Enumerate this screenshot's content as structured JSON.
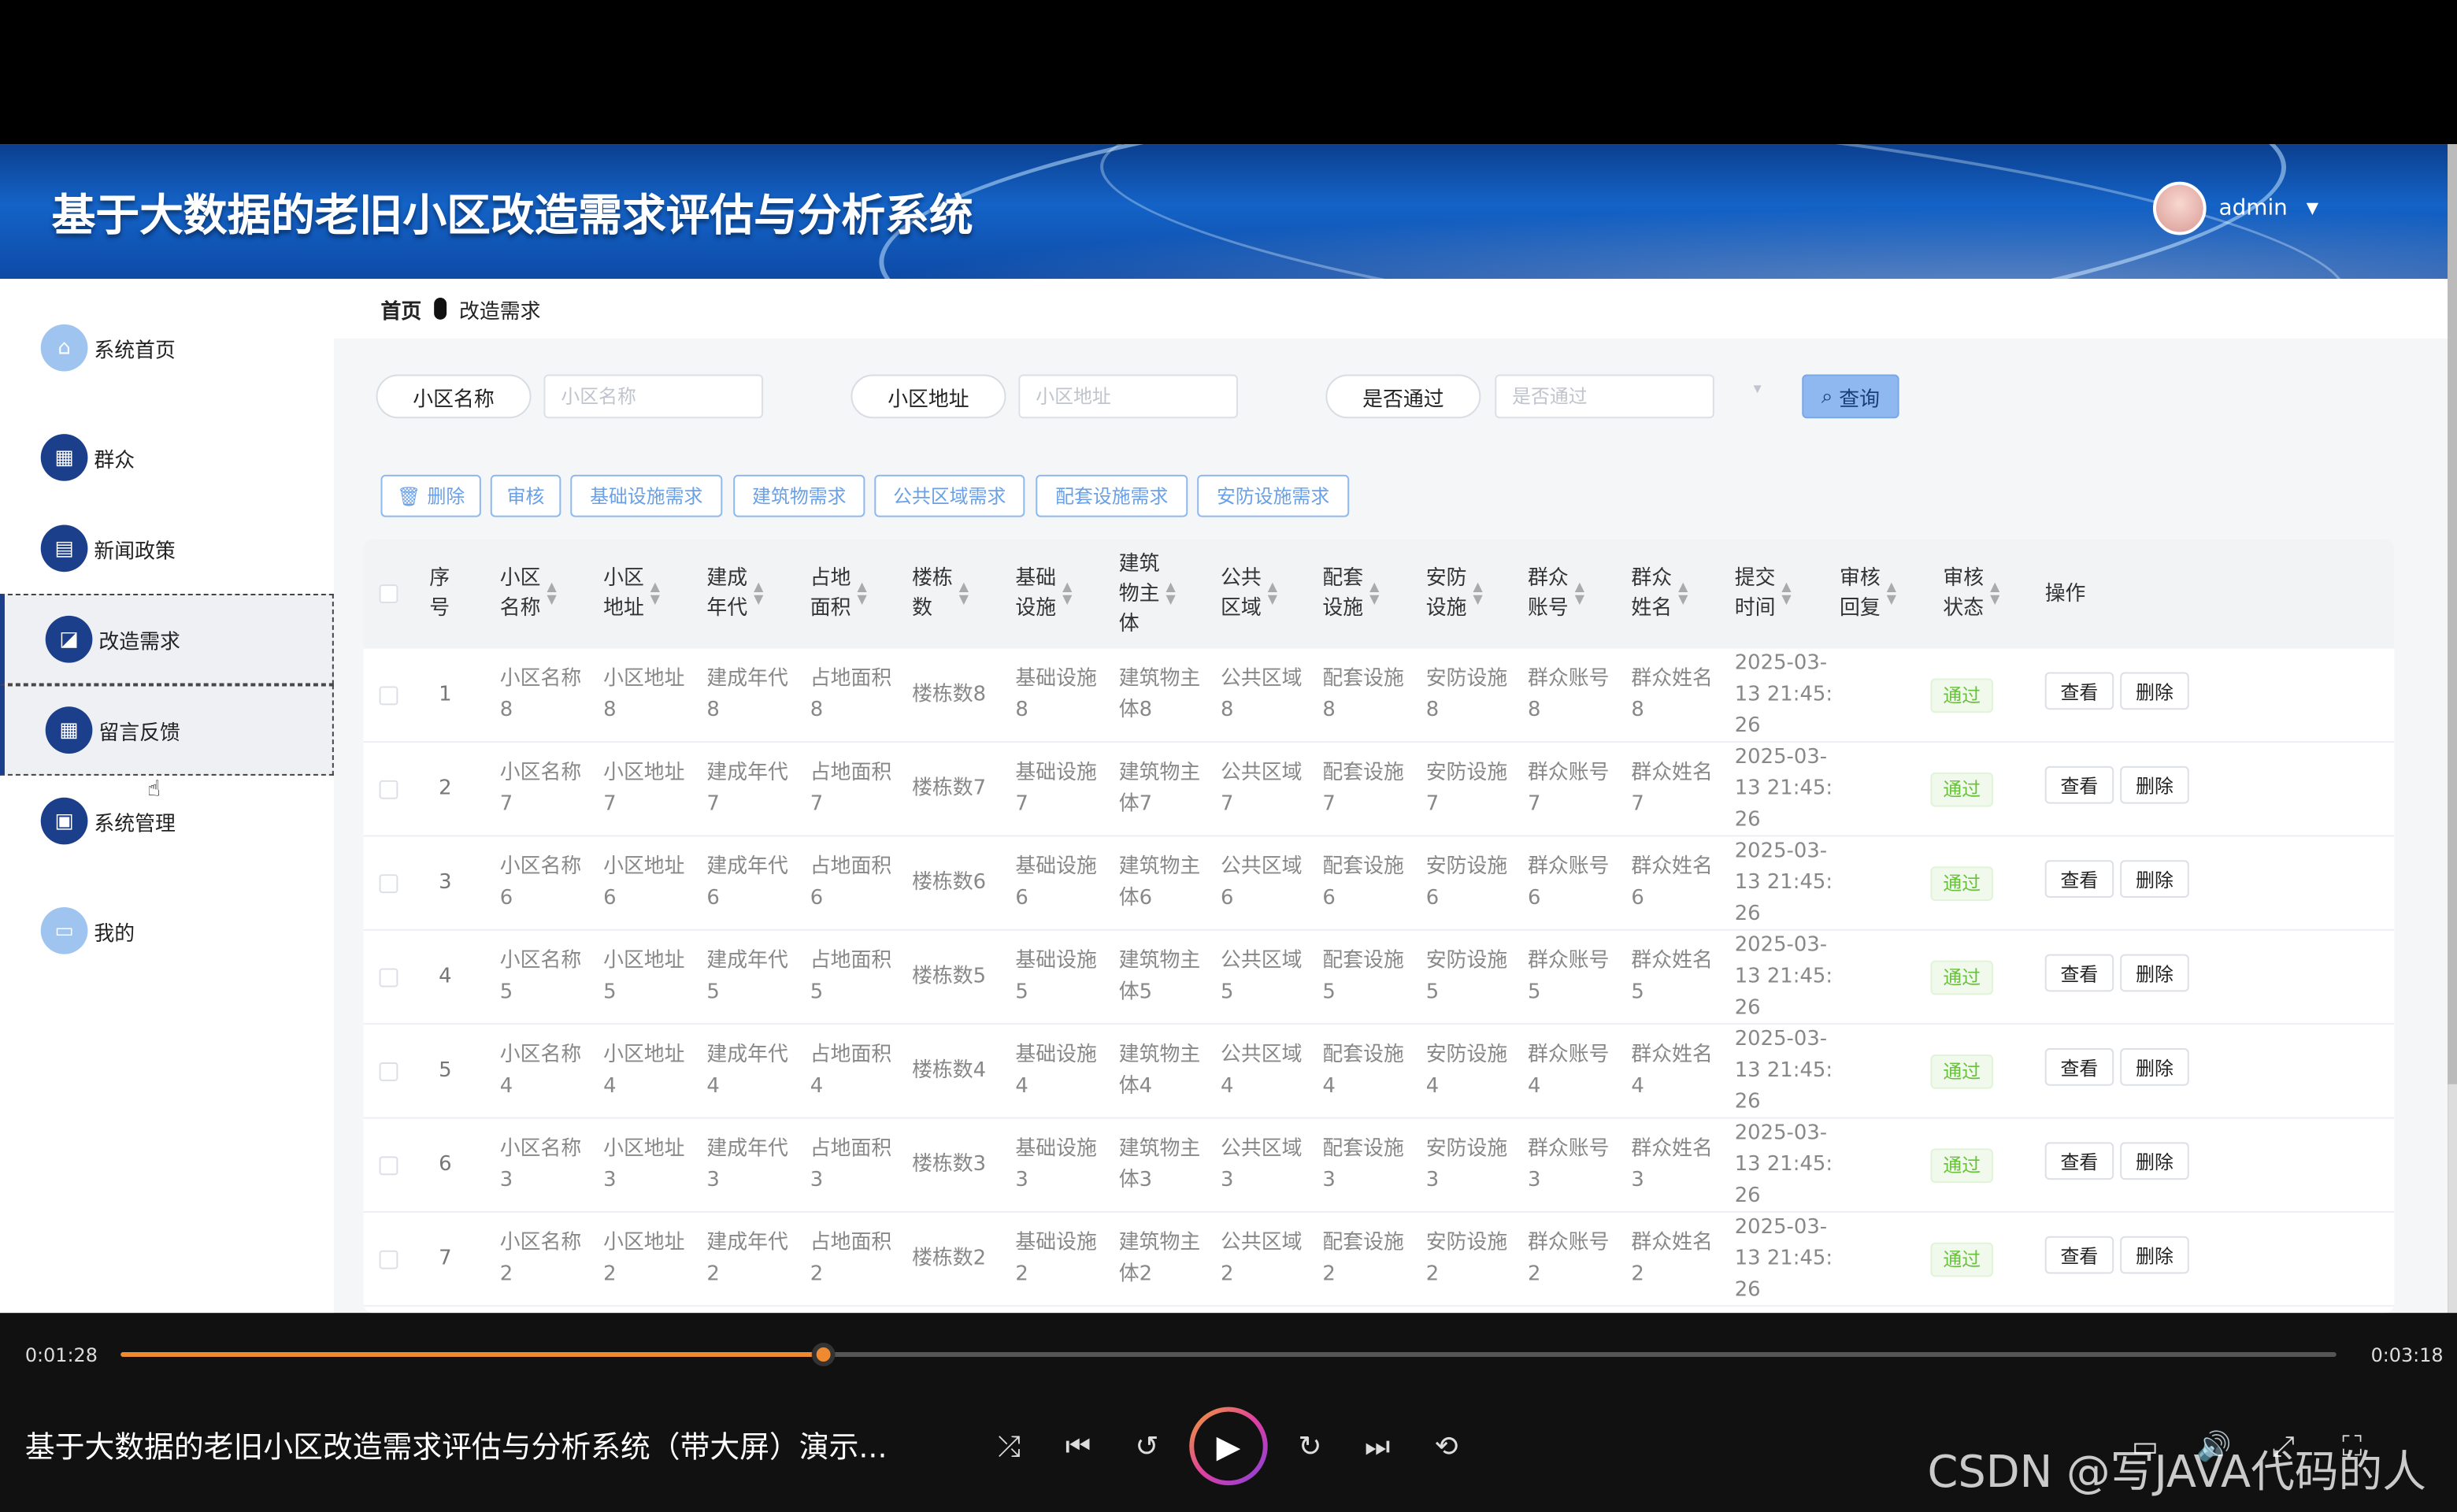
{
  "header": {
    "title": "基于大数据的老旧小区改造需求评估与分析系统",
    "user": "admin"
  },
  "sidebar": {
    "items": [
      {
        "label": "系统首页",
        "icon": "home-icon",
        "glyph": "⌂"
      },
      {
        "label": "群众",
        "icon": "grid-icon",
        "glyph": "▦"
      },
      {
        "label": "新闻政策",
        "icon": "message-icon",
        "glyph": "▤"
      },
      {
        "label": "改造需求",
        "icon": "ticket-icon",
        "glyph": "◪"
      },
      {
        "label": "留言反馈",
        "icon": "grid-icon",
        "glyph": "▦"
      },
      {
        "label": "系统管理",
        "icon": "briefcase-icon",
        "glyph": "▣"
      },
      {
        "label": "我的",
        "icon": "card-icon",
        "glyph": "▭"
      }
    ]
  },
  "breadcrumb": {
    "home": "首页",
    "current": "改造需求"
  },
  "filters": [
    {
      "label": "小区名称",
      "placeholder": "小区名称"
    },
    {
      "label": "小区地址",
      "placeholder": "小区地址"
    },
    {
      "label": "是否通过",
      "placeholder": "是否通过"
    }
  ],
  "query_label": "查询",
  "actions": [
    "删除",
    "审核",
    "基础设施需求",
    "建筑物需求",
    "公共区域需求",
    "配套设施需求",
    "安防设施需求"
  ],
  "table": {
    "columns": [
      "序号",
      "小区名称",
      "小区地址",
      "建成年代",
      "占地面积",
      "楼栋数",
      "基础设施",
      "建筑物主体",
      "公共区域",
      "配套设施",
      "安防设施",
      "群众账号",
      "群众姓名",
      "提交时间",
      "审核回复",
      "审核状态",
      "操作"
    ],
    "column_lines": [
      [
        "序",
        "号"
      ],
      [
        "小区",
        "名称"
      ],
      [
        "小区",
        "地址"
      ],
      [
        "建成",
        "年代"
      ],
      [
        "占地",
        "面积"
      ],
      [
        "楼栋",
        "数"
      ],
      [
        "基础",
        "设施"
      ],
      [
        "建筑",
        "物主",
        "体"
      ],
      [
        "公共",
        "区域"
      ],
      [
        "配套",
        "设施"
      ],
      [
        "安防",
        "设施"
      ],
      [
        "群众",
        "账号"
      ],
      [
        "群众",
        "姓名"
      ],
      [
        "提交",
        "时间"
      ],
      [
        "审核",
        "回复"
      ],
      [
        "审核",
        "状态"
      ],
      [
        "操作"
      ]
    ],
    "rows": [
      {
        "no": "1",
        "name": [
          "小区名称",
          "8"
        ],
        "addr": [
          "小区地址",
          "8"
        ],
        "year": [
          "建成年代",
          "8"
        ],
        "area": [
          "占地面积",
          "8"
        ],
        "bld": "楼栋数8",
        "base": [
          "基础设施",
          "8"
        ],
        "main": [
          "建筑物主",
          "体8"
        ],
        "pub": [
          "公共区域",
          "8"
        ],
        "sup": [
          "配套设施",
          "8"
        ],
        "sec": [
          "安防设施",
          "8"
        ],
        "acct": [
          "群众账号",
          "8"
        ],
        "uname": [
          "群众姓名",
          "8"
        ],
        "time": [
          "2025-03-",
          "13 21:45:",
          "26"
        ],
        "reply": "",
        "status": "通过"
      },
      {
        "no": "2",
        "name": [
          "小区名称",
          "7"
        ],
        "addr": [
          "小区地址",
          "7"
        ],
        "year": [
          "建成年代",
          "7"
        ],
        "area": [
          "占地面积",
          "7"
        ],
        "bld": "楼栋数7",
        "base": [
          "基础设施",
          "7"
        ],
        "main": [
          "建筑物主",
          "体7"
        ],
        "pub": [
          "公共区域",
          "7"
        ],
        "sup": [
          "配套设施",
          "7"
        ],
        "sec": [
          "安防设施",
          "7"
        ],
        "acct": [
          "群众账号",
          "7"
        ],
        "uname": [
          "群众姓名",
          "7"
        ],
        "time": [
          "2025-03-",
          "13 21:45:",
          "26"
        ],
        "reply": "",
        "status": "通过"
      },
      {
        "no": "3",
        "name": [
          "小区名称",
          "6"
        ],
        "addr": [
          "小区地址",
          "6"
        ],
        "year": [
          "建成年代",
          "6"
        ],
        "area": [
          "占地面积",
          "6"
        ],
        "bld": "楼栋数6",
        "base": [
          "基础设施",
          "6"
        ],
        "main": [
          "建筑物主",
          "体6"
        ],
        "pub": [
          "公共区域",
          "6"
        ],
        "sup": [
          "配套设施",
          "6"
        ],
        "sec": [
          "安防设施",
          "6"
        ],
        "acct": [
          "群众账号",
          "6"
        ],
        "uname": [
          "群众姓名",
          "6"
        ],
        "time": [
          "2025-03-",
          "13 21:45:",
          "26"
        ],
        "reply": "",
        "status": "通过"
      },
      {
        "no": "4",
        "name": [
          "小区名称",
          "5"
        ],
        "addr": [
          "小区地址",
          "5"
        ],
        "year": [
          "建成年代",
          "5"
        ],
        "area": [
          "占地面积",
          "5"
        ],
        "bld": "楼栋数5",
        "base": [
          "基础设施",
          "5"
        ],
        "main": [
          "建筑物主",
          "体5"
        ],
        "pub": [
          "公共区域",
          "5"
        ],
        "sup": [
          "配套设施",
          "5"
        ],
        "sec": [
          "安防设施",
          "5"
        ],
        "acct": [
          "群众账号",
          "5"
        ],
        "uname": [
          "群众姓名",
          "5"
        ],
        "time": [
          "2025-03-",
          "13 21:45:",
          "26"
        ],
        "reply": "",
        "status": "通过"
      },
      {
        "no": "5",
        "name": [
          "小区名称",
          "4"
        ],
        "addr": [
          "小区地址",
          "4"
        ],
        "year": [
          "建成年代",
          "4"
        ],
        "area": [
          "占地面积",
          "4"
        ],
        "bld": "楼栋数4",
        "base": [
          "基础设施",
          "4"
        ],
        "main": [
          "建筑物主",
          "体4"
        ],
        "pub": [
          "公共区域",
          "4"
        ],
        "sup": [
          "配套设施",
          "4"
        ],
        "sec": [
          "安防设施",
          "4"
        ],
        "acct": [
          "群众账号",
          "4"
        ],
        "uname": [
          "群众姓名",
          "4"
        ],
        "time": [
          "2025-03-",
          "13 21:45:",
          "26"
        ],
        "reply": "",
        "status": "通过"
      },
      {
        "no": "6",
        "name": [
          "小区名称",
          "3"
        ],
        "addr": [
          "小区地址",
          "3"
        ],
        "year": [
          "建成年代",
          "3"
        ],
        "area": [
          "占地面积",
          "3"
        ],
        "bld": "楼栋数3",
        "base": [
          "基础设施",
          "3"
        ],
        "main": [
          "建筑物主",
          "体3"
        ],
        "pub": [
          "公共区域",
          "3"
        ],
        "sup": [
          "配套设施",
          "3"
        ],
        "sec": [
          "安防设施",
          "3"
        ],
        "acct": [
          "群众账号",
          "3"
        ],
        "uname": [
          "群众姓名",
          "3"
        ],
        "time": [
          "2025-03-",
          "13 21:45:",
          "26"
        ],
        "reply": "",
        "status": "通过"
      },
      {
        "no": "7",
        "name": [
          "小区名称",
          "2"
        ],
        "addr": [
          "小区地址",
          "2"
        ],
        "year": [
          "建成年代",
          "2"
        ],
        "area": [
          "占地面积",
          "2"
        ],
        "bld": "楼栋数2",
        "base": [
          "基础设施",
          "2"
        ],
        "main": [
          "建筑物主",
          "体2"
        ],
        "pub": [
          "公共区域",
          "2"
        ],
        "sup": [
          "配套设施",
          "2"
        ],
        "sec": [
          "安防设施",
          "2"
        ],
        "acct": [
          "群众账号",
          "2"
        ],
        "uname": [
          "群众姓名",
          "2"
        ],
        "time": [
          "2025-03-",
          "13 21:45:",
          "26"
        ],
        "reply": "",
        "status": "通过"
      }
    ],
    "view_label": "查看",
    "delete_label": "删除"
  },
  "player": {
    "current_time": "0:01:28",
    "total_time": "0:03:18",
    "progress": 0.3165,
    "video_title": "基于大数据的老旧小区改造需求评估与分析系统（带大屏）演示...",
    "watermark": "CSDN @写JAVA代码的人",
    "accent": "#f08a30"
  }
}
